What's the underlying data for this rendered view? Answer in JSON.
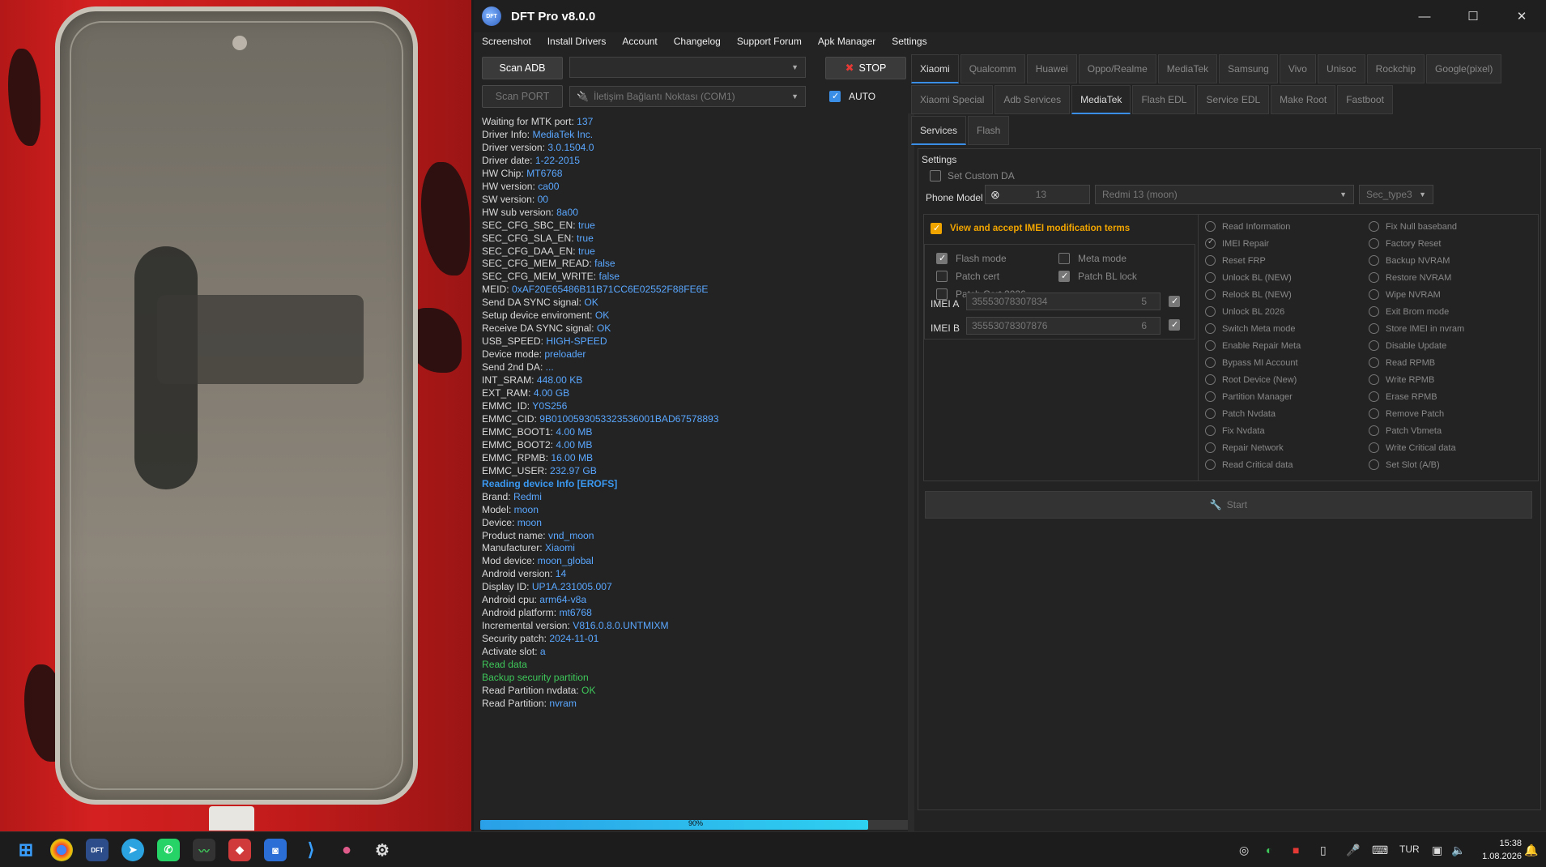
{
  "app": {
    "title": "DFT Pro v8.0.0",
    "logo_text": "DFT",
    "window_controls": [
      "—",
      "☐",
      "✕"
    ]
  },
  "menu": [
    "Screenshot",
    "Install Drivers",
    "Account",
    "Changelog",
    "Support Forum",
    "Apk Manager",
    "Settings"
  ],
  "toolbar": {
    "scan_adb": "Scan ADB",
    "stop": "STOP",
    "scan_port": "Scan PORT",
    "port_value": "İletişim Bağlantı Noktası (COM1)",
    "auto": "AUTO",
    "auto_checked": true
  },
  "log": [
    {
      "k": "Waiting for MTK port: ",
      "v": "137"
    },
    {
      "k": "Driver Info: ",
      "v": "MediaTek Inc."
    },
    {
      "k": "Driver version: ",
      "v": "3.0.1504.0"
    },
    {
      "k": "Driver date: ",
      "v": "1-22-2015"
    },
    {
      "k": "HW Chip: ",
      "v": "MT6768"
    },
    {
      "k": "HW version: ",
      "v": "ca00"
    },
    {
      "k": "SW version: ",
      "v": "00"
    },
    {
      "k": "HW sub version: ",
      "v": "8a00"
    },
    {
      "k": "SEC_CFG_SBC_EN: ",
      "v": "true"
    },
    {
      "k": "SEC_CFG_SLA_EN: ",
      "v": "true"
    },
    {
      "k": "SEC_CFG_DAA_EN: ",
      "v": "true"
    },
    {
      "k": "SEC_CFG_MEM_READ: ",
      "v": "false"
    },
    {
      "k": "SEC_CFG_MEM_WRITE: ",
      "v": "false"
    },
    {
      "k": "MEID: ",
      "v": "0xAF20E65486B11B71CC6E02552F88FE6E"
    },
    {
      "k": "Send DA SYNC signal: ",
      "v": "OK"
    },
    {
      "k": "Setup device enviroment: ",
      "v": "OK"
    },
    {
      "k": "Receive DA SYNC signal: ",
      "v": "OK"
    },
    {
      "k": "USB_SPEED: ",
      "v": "HIGH-SPEED"
    },
    {
      "k": "Device mode: ",
      "v": "preloader"
    },
    {
      "k": "Send 2nd DA: ",
      "v": "..."
    },
    {
      "k": "INT_SRAM: ",
      "v": "448.00 KB"
    },
    {
      "k": "EXT_RAM: ",
      "v": "4.00 GB"
    },
    {
      "k": "EMMC_ID: ",
      "v": "Y0S256"
    },
    {
      "k": "EMMC_CID: ",
      "v": "9B0100593053323536001BAD67578893"
    },
    {
      "k": "EMMC_BOOT1: ",
      "v": "4.00 MB"
    },
    {
      "k": "EMMC_BOOT2: ",
      "v": "4.00 MB"
    },
    {
      "k": "EMMC_RPMB: ",
      "v": "16.00 MB"
    },
    {
      "k": "EMMC_USER: ",
      "v": "232.97 GB"
    },
    {
      "h": "Reading device Info [EROFS]"
    },
    {
      "k": "Brand: ",
      "v": "Redmi"
    },
    {
      "k": "Model: ",
      "v": "moon"
    },
    {
      "k": "Device: ",
      "v": "moon"
    },
    {
      "k": "Product name: ",
      "v": "vnd_moon"
    },
    {
      "k": "Manufacturer: ",
      "v": "Xiaomi"
    },
    {
      "k": "Mod device: ",
      "v": "moon_global"
    },
    {
      "k": "Android version: ",
      "v": "14"
    },
    {
      "k": "Display ID: ",
      "v": "UP1A.231005.007"
    },
    {
      "k": "Android cpu: ",
      "v": "arm64-v8a"
    },
    {
      "k": "Android platform: ",
      "v": "mt6768"
    },
    {
      "k": "Incremental version: ",
      "v": "V816.0.8.0.UNTMIXM"
    },
    {
      "k": "Security patch: ",
      "v": "2024-11-01"
    },
    {
      "k": "Activate slot: ",
      "v": "a"
    },
    {
      "g": "Read data"
    },
    {
      "g": "Backup security partition"
    },
    {
      "k": "Read Partition nvdata: ",
      "v": "OK",
      "vg": true
    },
    {
      "k": "Read Partition: ",
      "v": "nvram"
    }
  ],
  "progress": {
    "value": 0.9,
    "label": "90%"
  },
  "brand_tabs": [
    "Xiaomi",
    "Qualcomm",
    "Huawei",
    "Oppo/Realme",
    "MediaTek",
    "Samsung",
    "Vivo",
    "Unisoc",
    "Rockchip",
    "Google(pixel)"
  ],
  "brand_tab_active": "Xiaomi",
  "sub_tabs": [
    "Xiaomi Special",
    "Adb Services",
    "MediaTek",
    "Flash EDL",
    "Service EDL",
    "Make Root",
    "Fastboot"
  ],
  "sub_tab_active": "MediaTek",
  "inner_tabs": [
    "Services",
    "Flash"
  ],
  "inner_tab_active": "Services",
  "settings": {
    "title": "Settings",
    "custom_da": "Set Custom DA",
    "phone_model_label": "Phone Model :",
    "search_value": "13",
    "model_value": "Redmi 13 (moon)",
    "sec_type": "Sec_type3"
  },
  "imei": {
    "terms": "View and accept IMEI modification terms",
    "flash_mode": "Flash mode",
    "meta_mode": "Meta mode",
    "patch_cert": "Patch cert",
    "patch_bl_lock": "Patch BL lock",
    "patch_cert_2026": "Patch Cert 2026",
    "imei_a_label": "IMEI A",
    "imei_a": "35553078307834",
    "imei_a_check": "5",
    "imei_b_label": "IMEI B",
    "imei_b": "35553078307876",
    "imei_b_check": "6"
  },
  "ops_left": [
    "Read Information",
    "IMEI Repair",
    "Reset FRP",
    "Unlock BL (NEW)",
    "Relock BL (NEW)",
    "Unlock BL 2026",
    "Switch Meta mode",
    "Enable Repair Meta",
    "Bypass MI Account",
    "Root Device (New)",
    "Partition Manager",
    "Patch Nvdata",
    "Fix Nvdata",
    "Repair Network",
    "Read Critical data"
  ],
  "ops_right": [
    "Fix Null baseband",
    "Factory Reset",
    "Backup NVRAM",
    "Restore NVRAM",
    "Wipe NVRAM",
    "Exit Brom mode",
    "Store IMEI in nvram",
    "Disable Update",
    "Read RPMB",
    "Write RPMB",
    "Erase RPMB",
    "Remove Patch",
    "Patch Vbmeta",
    "Write Critical data",
    "Set Slot (A/B)"
  ],
  "ops_selected": "IMEI Repair",
  "start_label": "Start",
  "taskbar": {
    "lang": "TUR",
    "time": "15:38",
    "date": "1.08.2026"
  },
  "colors": {
    "accent": "#3a8ee6",
    "log_value": "#5aa7ff",
    "log_ok": "#3ec75a",
    "terms": "#f0a400"
  }
}
